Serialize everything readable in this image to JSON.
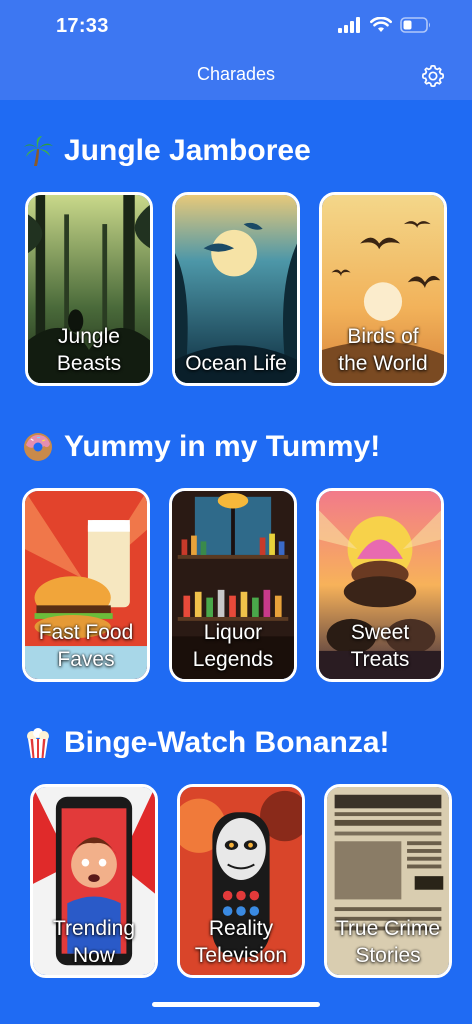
{
  "status": {
    "time": "17:33"
  },
  "nav": {
    "title": "Charades"
  },
  "sections": [
    {
      "title": "Jungle Jamboree",
      "emoji": "palm-tree-icon",
      "cards": [
        {
          "label": "Jungle\nBeasts"
        },
        {
          "label": "Ocean Life"
        },
        {
          "label": "Birds of\nthe World"
        }
      ]
    },
    {
      "title": "Yummy in my Tummy!",
      "emoji": "donut-icon",
      "cards": [
        {
          "label": "Fast Food\nFaves"
        },
        {
          "label": "Liquor\nLegends"
        },
        {
          "label": "Sweet\nTreats"
        }
      ]
    },
    {
      "title": "Binge-Watch Bonanza!",
      "emoji": "popcorn-icon",
      "cards": [
        {
          "label": "Trending\nNow"
        },
        {
          "label": "Reality\nTelevision"
        },
        {
          "label": "True Crime\nStories"
        }
      ]
    }
  ],
  "colors": {
    "background": "#1F6BF3",
    "header": "#3D77F2",
    "card_border": "#FFFFFF"
  }
}
